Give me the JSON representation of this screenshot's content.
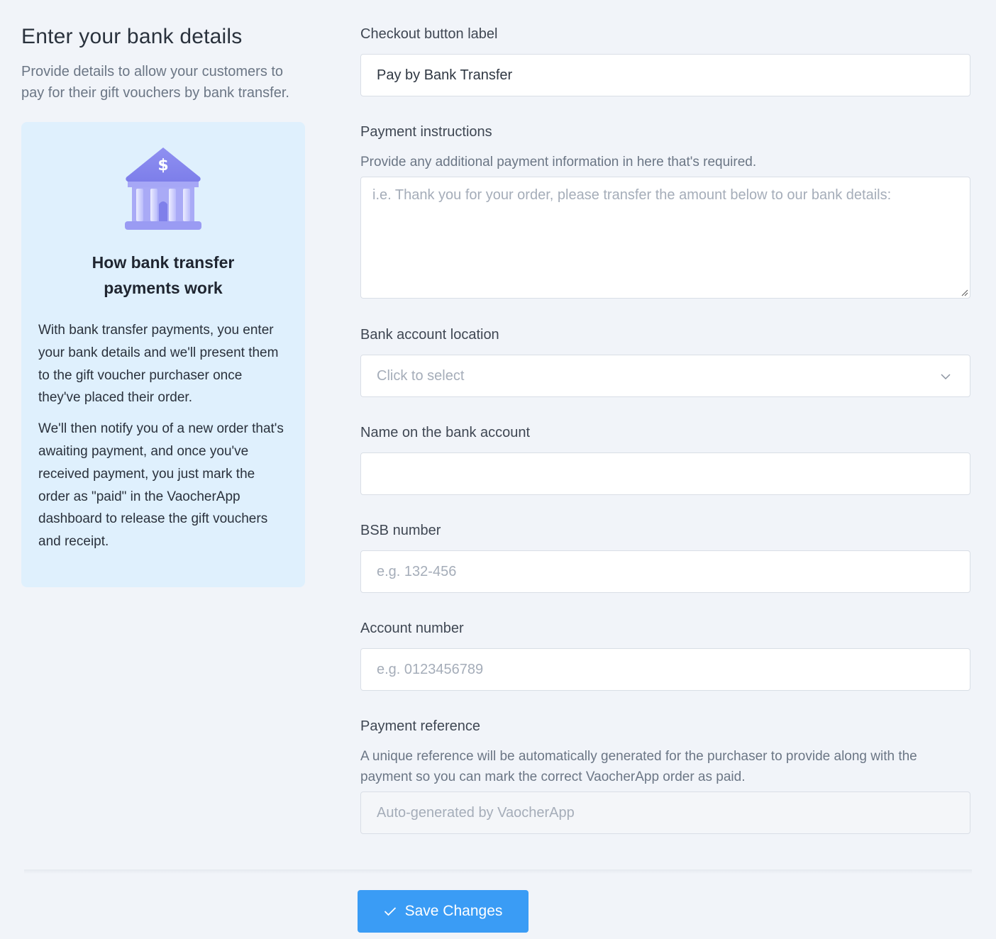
{
  "left": {
    "title": "Enter your bank details",
    "description": "Provide details to allow your customers to pay for their gift vouchers by bank transfer.",
    "info_card": {
      "icon": "bank-icon",
      "title": "How bank transfer payments work",
      "paragraph_1": "With bank transfer payments, you enter your bank details and we'll present them to the gift voucher purchaser once they've placed their order.",
      "paragraph_2": "We'll then notify you of a new order that's awaiting payment, and once you've received payment, you just mark the order as \"paid\" in the VaocherApp dashboard to release the gift vouchers and receipt."
    }
  },
  "form": {
    "checkout_label": {
      "label": "Checkout button label",
      "value": "Pay by Bank Transfer"
    },
    "payment_instructions": {
      "label": "Payment instructions",
      "help": "Provide any additional payment information in here that's required.",
      "placeholder": "i.e. Thank you for your order, please transfer the amount below to our bank details:"
    },
    "bank_location": {
      "label": "Bank account location",
      "placeholder": "Click to select"
    },
    "account_name": {
      "label": "Name on the bank account",
      "value": ""
    },
    "bsb_number": {
      "label": "BSB number",
      "placeholder": "e.g. 132-456"
    },
    "account_number": {
      "label": "Account number",
      "placeholder": "e.g. 0123456789"
    },
    "payment_reference": {
      "label": "Payment reference",
      "help": "A unique reference will be automatically generated for the purchaser to provide along with the payment so you can mark the correct VaocherApp order as paid.",
      "placeholder": "Auto-generated by VaocherApp"
    }
  },
  "footer": {
    "save_label": "Save Changes"
  },
  "colors": {
    "accent": "#3a9cf5",
    "card_bg": "#dff0fd",
    "page_bg": "#f1f4f9",
    "icon_purple": "#9a9bf3"
  }
}
